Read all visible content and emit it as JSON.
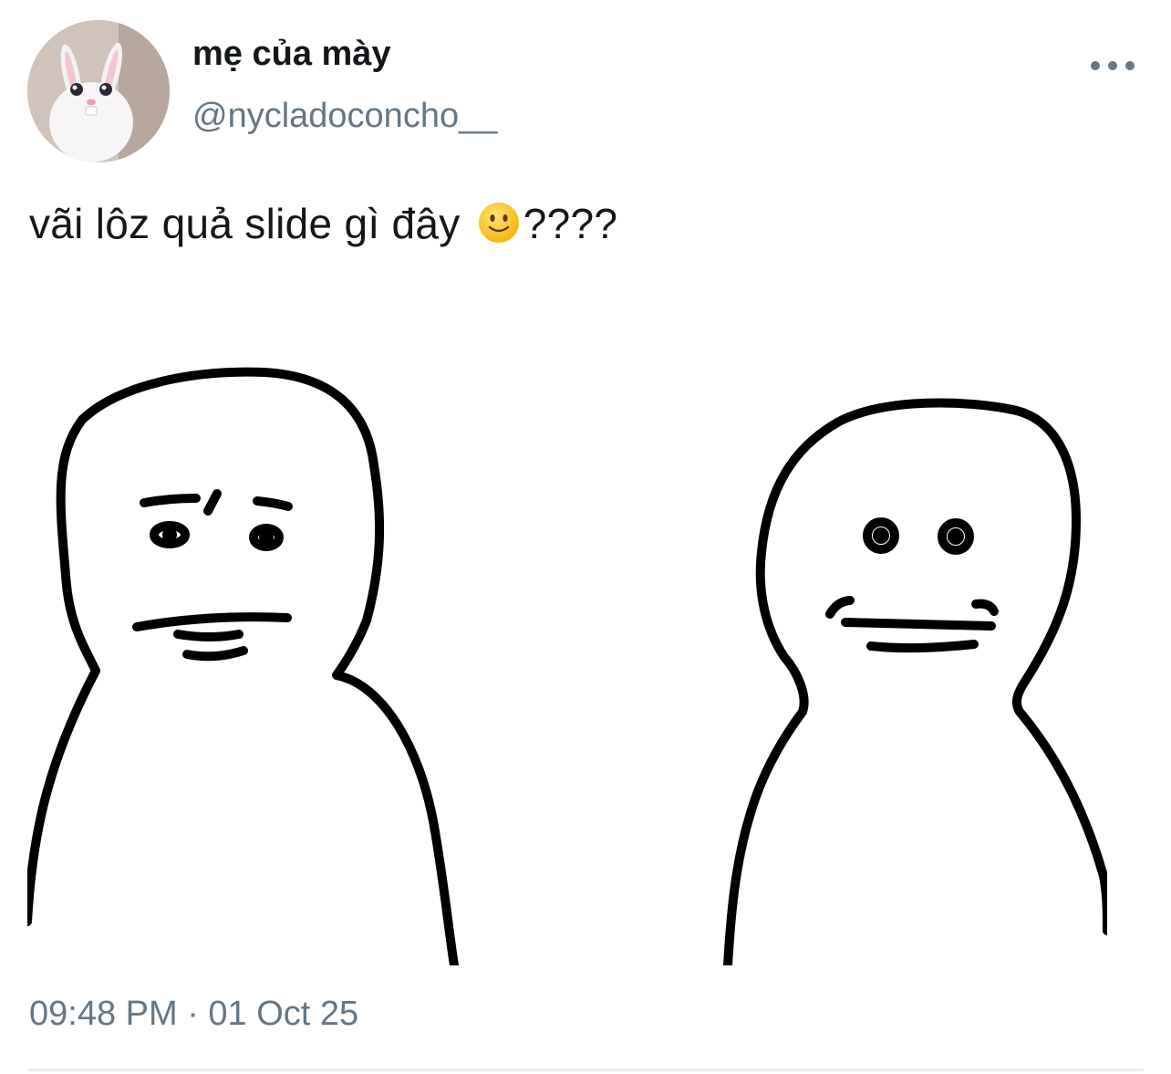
{
  "tweet": {
    "display_name": "mẹ của mày",
    "handle": "@nycladoconcho__",
    "text_before_emoji": "vãi lôz quả slide gì đây",
    "emoji": "slightly-smiling-face",
    "text_after_emoji": "????",
    "timestamp": "09:48 PM · 01 Oct 25"
  },
  "icons": {
    "more": "more-horizontal-icon"
  },
  "colors": {
    "text_primary": "#14171a",
    "text_secondary": "#657786",
    "divider": "#e6ecf0"
  }
}
